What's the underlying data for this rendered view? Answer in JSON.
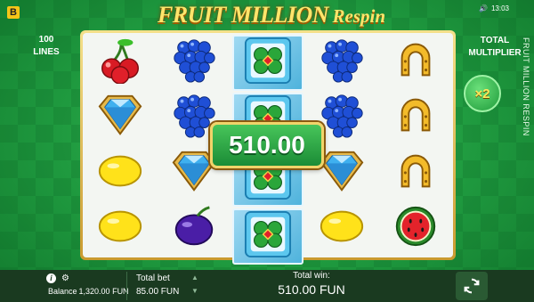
{
  "header": {
    "logo_letter": "B",
    "title_main": "FRUIT MILLION",
    "title_sub": "Respin",
    "time": "13:03",
    "vertical_label": "FRUIT MILLION RESPIN"
  },
  "left_panel": {
    "lines_count": "100",
    "lines_label": "LINES"
  },
  "right_panel": {
    "mult_label_1": "TOTAL",
    "mult_label_2": "MULTIPLIER",
    "multiplier": "×2"
  },
  "win_popup": {
    "amount": "510.00"
  },
  "reels": [
    [
      "cherry-icon",
      "diamond-icon",
      "lemon-icon",
      "lemon-icon"
    ],
    [
      "grapes-icon",
      "grapes-icon",
      "diamond-icon",
      "plum-icon"
    ],
    [
      "clover-icon",
      "clover-icon",
      "clover-icon",
      "clover-icon"
    ],
    [
      "grapes-icon",
      "grapes-icon",
      "diamond-icon",
      "lemon-icon"
    ],
    [
      "horseshoe-icon",
      "horseshoe-icon",
      "horseshoe-icon",
      "watermelon-icon"
    ]
  ],
  "footer": {
    "balance_label": "Balance",
    "balance_value": "1,320.00 FUN",
    "total_bet_label": "Total bet",
    "total_bet_value": "85.00 FUN",
    "total_win_label": "Total win:",
    "total_win_value": "510.00 FUN"
  },
  "colors": {
    "accent_gold": "#f1d46a",
    "bg_green": "#1f9a3f"
  }
}
